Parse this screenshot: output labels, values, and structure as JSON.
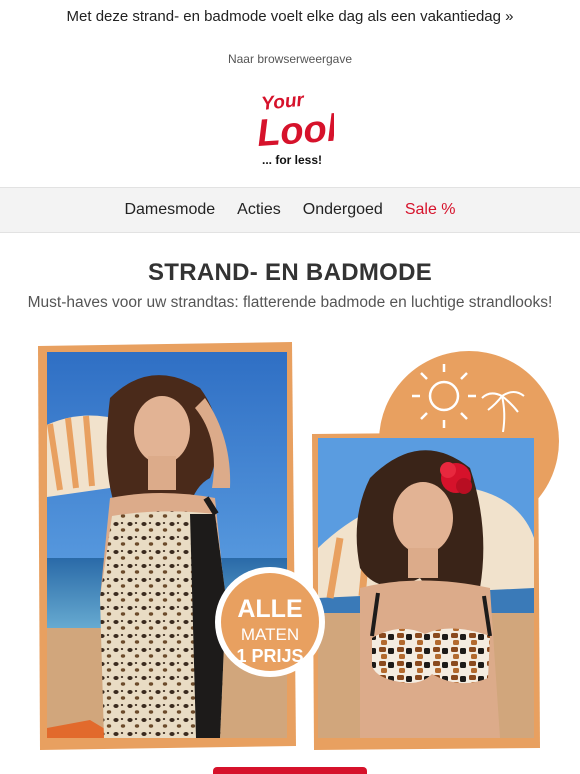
{
  "preheader": {
    "text": "Met deze strand- en badmode voelt elke dag als een vakantiedag »"
  },
  "browser_link": {
    "text": "Naar browserweergave"
  },
  "logo": {
    "line1": "Your",
    "line2": "Look",
    "tagline": "... for less!",
    "color": "#d6122b"
  },
  "nav": {
    "items": [
      {
        "label": "Damesmode"
      },
      {
        "label": "Acties"
      },
      {
        "label": "Ondergoed"
      },
      {
        "label": "Sale %"
      }
    ],
    "sale_color": "#d6122b"
  },
  "headline": "STRAND- EN BADMODE",
  "subline": "Must-haves voor uw strandtas: flatterende badmode en luchtige strandlooks!",
  "badge": {
    "line1": "ALLE",
    "line2": "MATEN",
    "line3": "1 PRIJS"
  },
  "colors": {
    "accent_orange": "#e8a060",
    "brand_red": "#d6122b"
  }
}
